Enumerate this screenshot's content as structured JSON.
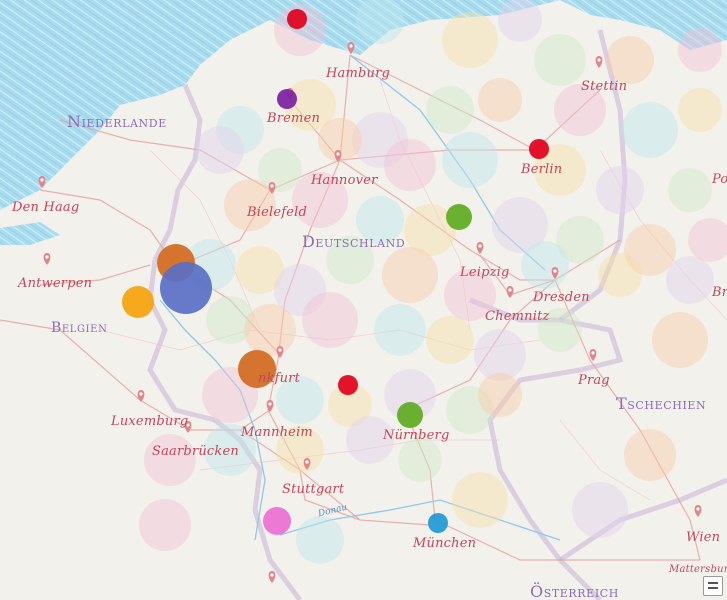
{
  "map": {
    "countries": [
      {
        "name": "Niederlande",
        "key": "niederlande"
      },
      {
        "name": "Deutschland",
        "key": "deutschland"
      },
      {
        "name": "Belgien",
        "key": "belgien"
      },
      {
        "name": "Tschechien",
        "key": "tschechien"
      },
      {
        "name": "Österreich",
        "key": "oesterreich"
      }
    ],
    "cities": [
      {
        "name": "Hamburg",
        "key": "hamburg"
      },
      {
        "name": "Stettin",
        "key": "stettin"
      },
      {
        "name": "Bremen",
        "key": "bremen"
      },
      {
        "name": "Hannover",
        "key": "hannover"
      },
      {
        "name": "Berlin",
        "key": "berlin"
      },
      {
        "name": "Den Haag",
        "key": "den-haag"
      },
      {
        "name": "Bielefeld",
        "key": "bielefeld"
      },
      {
        "name": "Po",
        "key": "poznan"
      },
      {
        "name": "Leipzig",
        "key": "leipzig"
      },
      {
        "name": "Dresden",
        "key": "dresden"
      },
      {
        "name": "Antwerpen",
        "key": "antwerpen"
      },
      {
        "name": "Chemnitz",
        "key": "chemnitz"
      },
      {
        "name": "Br",
        "key": "breslau"
      },
      {
        "name": "Prag",
        "key": "prag"
      },
      {
        "name": "nkfurt",
        "key": "frankfurt"
      },
      {
        "name": "Luxemburg",
        "key": "luxemburg"
      },
      {
        "name": "Saarbrücken",
        "key": "saarbruecken"
      },
      {
        "name": "Mannheim",
        "key": "mannheim"
      },
      {
        "name": "Nürnberg",
        "key": "nuernberg"
      },
      {
        "name": "Stuttgart",
        "key": "stuttgart"
      },
      {
        "name": "München",
        "key": "muenchen"
      },
      {
        "name": "Wien",
        "key": "wien"
      },
      {
        "name": "Mattersburg",
        "key": "mattersburg"
      }
    ],
    "rivers": [
      {
        "name": "Donau",
        "key": "donau"
      }
    ],
    "colors": {
      "sea": "#a9dcef",
      "land": "#f3f1ec",
      "city_label": "#c0475a",
      "country_label": "#8a6fb3",
      "river_label": "#4a8fc9",
      "road": "#e6a3a3"
    },
    "point_colors": [
      "#e2001a",
      "#7b1fa2",
      "#5eab1f",
      "#d2691e",
      "#5b6fc6",
      "#f7a30b",
      "#ec6fd0",
      "#1e9ad6"
    ]
  }
}
